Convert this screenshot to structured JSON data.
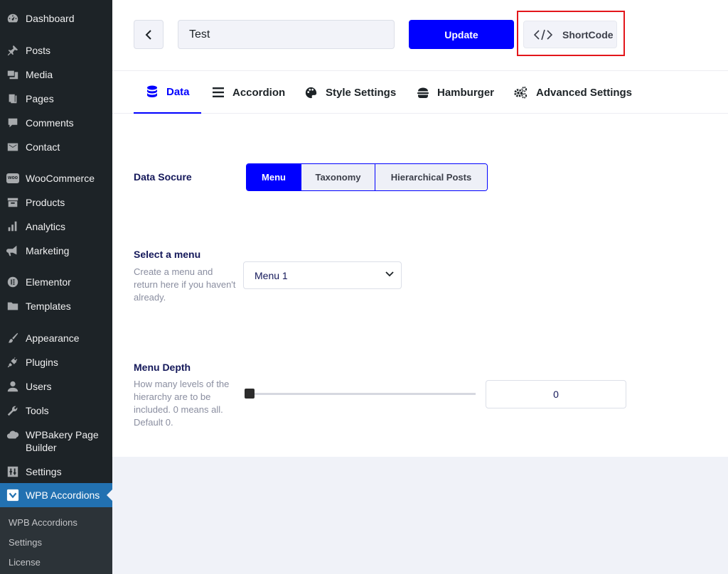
{
  "sidebar": {
    "items": [
      {
        "label": "Dashboard",
        "icon": "dashboard-icon"
      },
      {
        "label": "Posts",
        "icon": "pin-icon"
      },
      {
        "label": "Media",
        "icon": "media-icon"
      },
      {
        "label": "Pages",
        "icon": "pages-icon"
      },
      {
        "label": "Comments",
        "icon": "comment-icon"
      },
      {
        "label": "Contact",
        "icon": "mail-icon"
      },
      {
        "label": "WooCommerce",
        "icon": "woo-icon",
        "badge": "woo"
      },
      {
        "label": "Products",
        "icon": "archive-icon"
      },
      {
        "label": "Analytics",
        "icon": "bar-chart-icon"
      },
      {
        "label": "Marketing",
        "icon": "megaphone-icon"
      },
      {
        "label": "Elementor",
        "icon": "elementor-icon"
      },
      {
        "label": "Templates",
        "icon": "folder-icon"
      },
      {
        "label": "Appearance",
        "icon": "brush-icon"
      },
      {
        "label": "Plugins",
        "icon": "plug-icon"
      },
      {
        "label": "Users",
        "icon": "user-icon"
      },
      {
        "label": "Tools",
        "icon": "wrench-icon"
      },
      {
        "label": "WPBakery Page Builder",
        "icon": "cloud-icon"
      },
      {
        "label": "Settings",
        "icon": "settings-icon"
      },
      {
        "label": "WPB Accordions",
        "icon": "checkbox-icon",
        "active": true
      }
    ],
    "submenu": [
      {
        "label": "WPB Accordions"
      },
      {
        "label": "Settings"
      },
      {
        "label": "License"
      }
    ]
  },
  "toolbar": {
    "title_value": "Test",
    "update_label": "Update",
    "shortcode_label": "ShortCode"
  },
  "tabs": [
    {
      "label": "Data",
      "icon": "database-icon",
      "active": true
    },
    {
      "label": "Accordion",
      "icon": "list-icon"
    },
    {
      "label": "Style Settings",
      "icon": "palette-icon"
    },
    {
      "label": "Hamburger",
      "icon": "hamburger-icon"
    },
    {
      "label": "Advanced Settings",
      "icon": "gears-icon"
    }
  ],
  "data_source": {
    "title": "Data Socure",
    "options": [
      "Menu",
      "Taxonomy",
      "Hierarchical Posts"
    ],
    "selected": "Menu"
  },
  "select_menu": {
    "title": "Select a menu",
    "description": "Create a menu and return here if you haven't already.",
    "value": "Menu 1"
  },
  "menu_depth": {
    "title": "Menu Depth",
    "description": "How many levels of the hierarchy are to be included. 0 means all. Default 0.",
    "value": "0",
    "slider_fraction": 0
  },
  "colors": {
    "accent": "#0000ff",
    "sidebar_bg": "#1d2327",
    "sidebar_active": "#2271b1",
    "highlight_box": "#e3161b"
  }
}
